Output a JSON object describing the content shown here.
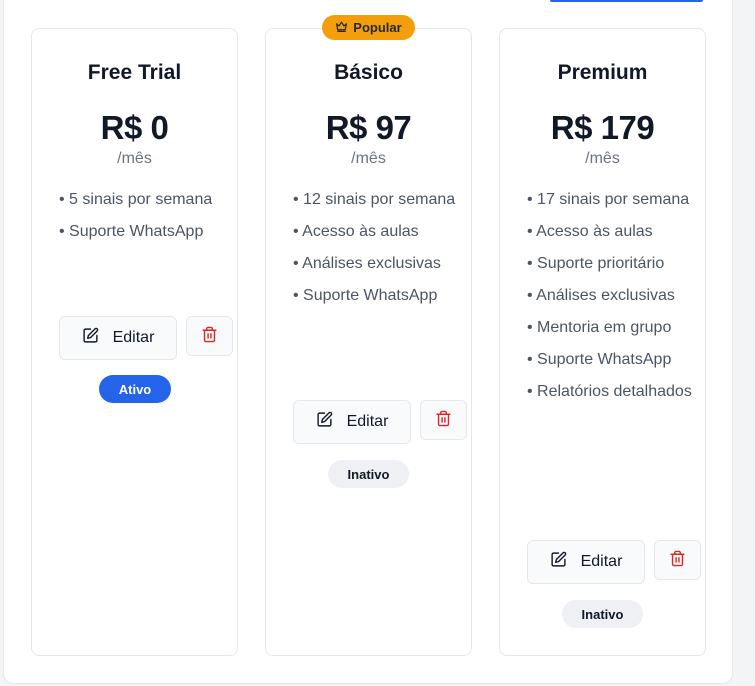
{
  "popular_badge": {
    "label": "Popular",
    "icon": "crown-icon",
    "color": "#f59e0b"
  },
  "plans": [
    {
      "name": "Free Trial",
      "price": "R$ 0",
      "period": "/mês",
      "features": [
        "5 sinais por semana",
        "Suporte WhatsApp"
      ],
      "edit_label": "Editar",
      "status": "Ativo"
    },
    {
      "name": "Básico",
      "price": "R$ 97",
      "period": "/mês",
      "features": [
        "12 sinais por semana",
        "Acesso às aulas",
        "Análises exclusivas",
        "Suporte WhatsApp"
      ],
      "edit_label": "Editar",
      "status": "Inativo"
    },
    {
      "name": "Premium",
      "price": "R$ 179",
      "period": "/mês",
      "features": [
        "17 sinais por semana",
        "Acesso às aulas",
        "Suporte prioritário",
        "Análises exclusivas",
        "Mentoria em grupo",
        "Suporte WhatsApp",
        "Relatórios detalhados"
      ],
      "edit_label": "Editar",
      "status": "Inativo"
    }
  ],
  "colors": {
    "accent": "#2563eb",
    "popular": "#f59e0b",
    "delete": "#dc2626",
    "inactive_badge": "#eef0f4"
  }
}
